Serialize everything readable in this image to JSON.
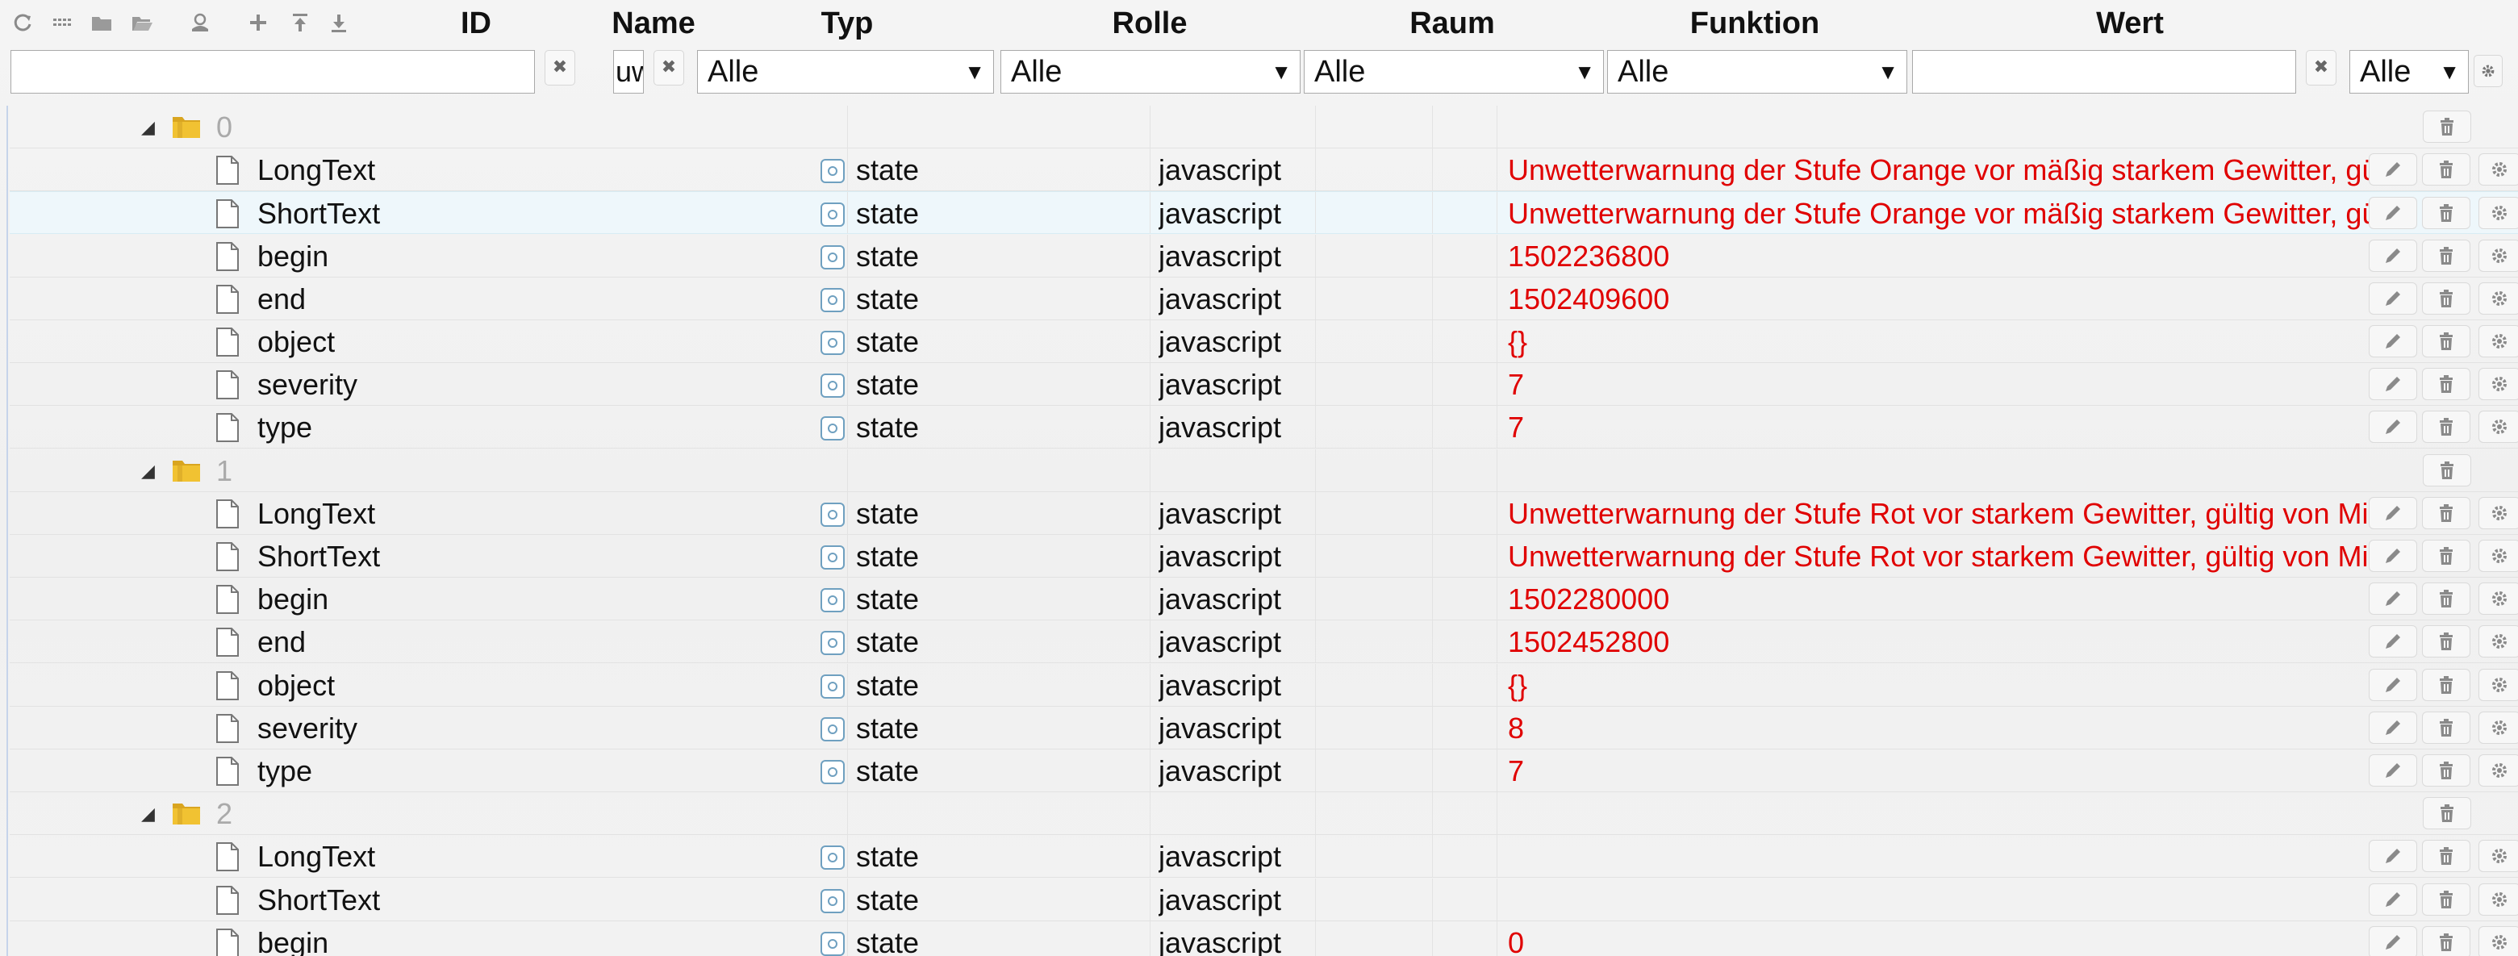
{
  "toolbar": {
    "icons": [
      "refresh-icon",
      "list-icon",
      "folder-closed-icon",
      "folder-open-icon",
      "user-icon",
      "add-icon",
      "upload-icon",
      "download-icon"
    ]
  },
  "columns": {
    "id": "ID",
    "name": "Name",
    "typ": "Typ",
    "rolle": "Rolle",
    "raum": "Raum",
    "funktion": "Funktion",
    "wert": "Wert"
  },
  "filters": {
    "id_value": "",
    "name_value": "uw",
    "typ": "Alle",
    "rolle": "Alle",
    "raum": "Alle",
    "funktion": "Alle",
    "wert_value": "",
    "last": "Alle"
  },
  "rows": [
    {
      "kind": "folder",
      "name": "0"
    },
    {
      "kind": "state",
      "name": "LongText",
      "type": "state",
      "role": "javascript",
      "value": "Unwetterwarnung der Stufe Orange vor mäßig starkem Gewitter, gültig"
    },
    {
      "kind": "state",
      "name": "ShortText",
      "type": "state",
      "role": "javascript",
      "value": "Unwetterwarnung der Stufe Orange vor mäßig starkem Gewitter, gültig",
      "highlight": true
    },
    {
      "kind": "state",
      "name": "begin",
      "type": "state",
      "role": "javascript",
      "value": "1502236800"
    },
    {
      "kind": "state",
      "name": "end",
      "type": "state",
      "role": "javascript",
      "value": "1502409600"
    },
    {
      "kind": "state",
      "name": "object",
      "type": "state",
      "role": "javascript",
      "value": "{}"
    },
    {
      "kind": "state",
      "name": "severity",
      "type": "state",
      "role": "javascript",
      "value": "7"
    },
    {
      "kind": "state",
      "name": "type",
      "type": "state",
      "role": "javascript",
      "value": "7"
    },
    {
      "kind": "folder",
      "name": "1"
    },
    {
      "kind": "state",
      "name": "LongText",
      "type": "state",
      "role": "javascript",
      "value": "Unwetterwarnung der Stufe Rot vor starkem Gewitter, gültig von Mitt"
    },
    {
      "kind": "state",
      "name": "ShortText",
      "type": "state",
      "role": "javascript",
      "value": "Unwetterwarnung der Stufe Rot vor starkem Gewitter, gültig von Mitt"
    },
    {
      "kind": "state",
      "name": "begin",
      "type": "state",
      "role": "javascript",
      "value": "1502280000"
    },
    {
      "kind": "state",
      "name": "end",
      "type": "state",
      "role": "javascript",
      "value": "1502452800"
    },
    {
      "kind": "state",
      "name": "object",
      "type": "state",
      "role": "javascript",
      "value": "{}"
    },
    {
      "kind": "state",
      "name": "severity",
      "type": "state",
      "role": "javascript",
      "value": "8"
    },
    {
      "kind": "state",
      "name": "type",
      "type": "state",
      "role": "javascript",
      "value": "7"
    },
    {
      "kind": "folder",
      "name": "2"
    },
    {
      "kind": "state",
      "name": "LongText",
      "type": "state",
      "role": "javascript",
      "value": ""
    },
    {
      "kind": "state",
      "name": "ShortText",
      "type": "state",
      "role": "javascript",
      "value": ""
    },
    {
      "kind": "state",
      "name": "begin",
      "type": "state",
      "role": "javascript",
      "value": "0"
    }
  ],
  "colors": {
    "value_text": "#e00000",
    "folder_number": "#aaaaaa",
    "selected_row": "#eef7fb",
    "state_icon": "#5c8fb0"
  }
}
